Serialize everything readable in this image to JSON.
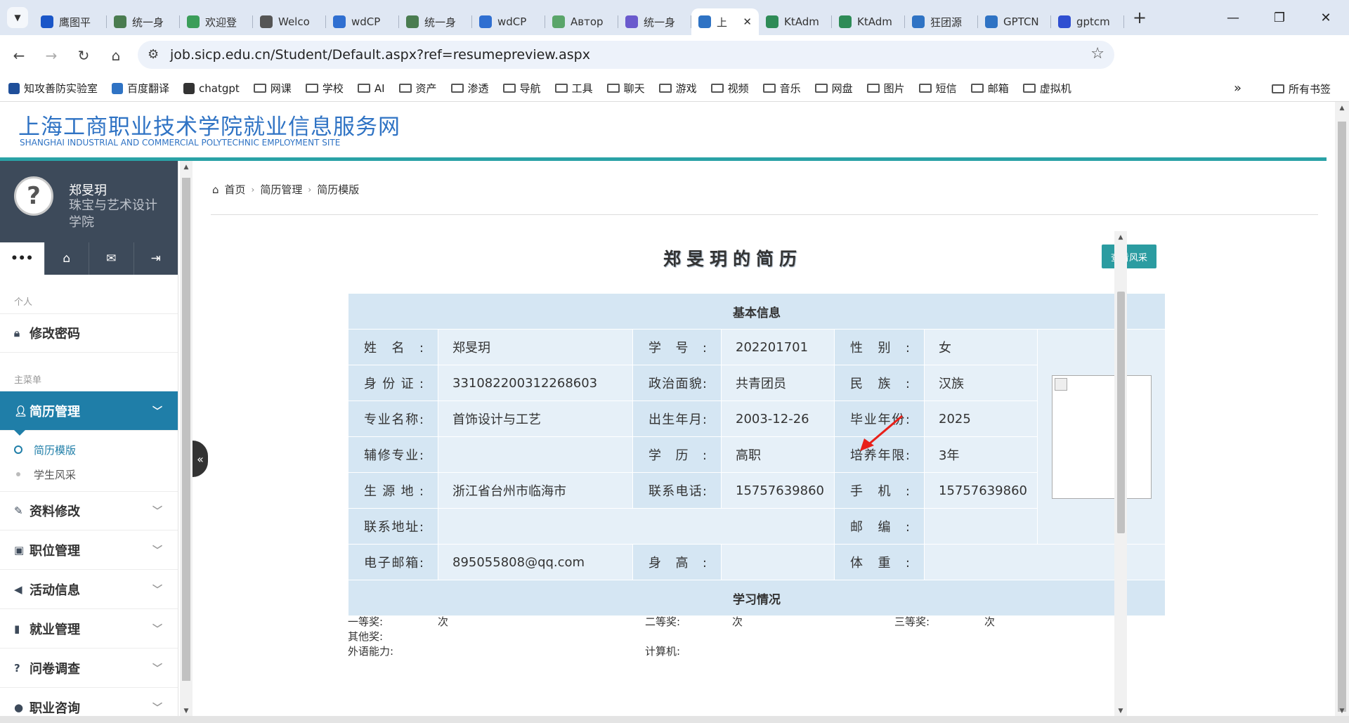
{
  "browser": {
    "tabs": [
      {
        "title": "鹰图平",
        "fav_color": "#1a56c8"
      },
      {
        "title": "统一身",
        "fav_color": "#4a7c50"
      },
      {
        "title": "欢迎登",
        "fav_color": "#3b9e5a"
      },
      {
        "title": "Welco",
        "fav_color": "#555555"
      },
      {
        "title": "wdCP",
        "fav_color": "#2f6fd1"
      },
      {
        "title": "统一身",
        "fav_color": "#4a7c50"
      },
      {
        "title": "wdCP",
        "fav_color": "#2f6fd1"
      },
      {
        "title": "Автор",
        "fav_color": "#5aa56a"
      },
      {
        "title": "统一身",
        "fav_color": "#6a5acd"
      },
      {
        "title": "上",
        "fav_color": "#2f73c4",
        "active": true
      },
      {
        "title": "KtAdm",
        "fav_color": "#2e8b57"
      },
      {
        "title": "KtAdm",
        "fav_color": "#2e8b57"
      },
      {
        "title": "狂团源",
        "fav_color": "#2f73c4"
      },
      {
        "title": "GPTCN",
        "fav_color": "#2f73c4"
      },
      {
        "title": "gptcm",
        "fav_color": "#2f4fd1"
      }
    ],
    "url": "job.sicp.edu.cn/Student/Default.aspx?ref=resumepreview.aspx",
    "bookmarks": [
      "知攻善防实验室",
      "百度翻译",
      "chatgpt",
      "网课",
      "学校",
      "AI",
      "资产",
      "渗透",
      "导航",
      "工具",
      "聊天",
      "游戏",
      "视频",
      "音乐",
      "网盘",
      "图片",
      "短信",
      "邮箱",
      "虚拟机"
    ],
    "all_bookmarks": "所有书签"
  },
  "site": {
    "title_cn": "上海工商职业技术学院就业信息服务网",
    "title_en": "SHANGHAI INDUSTRIAL AND COMMERCIAL POLYTECHNIC EMPLOYMENT SITE"
  },
  "sidebar": {
    "user_name": "郑旻玥",
    "user_dept": "珠宝与艺术设计学院",
    "section_personal": "个人",
    "change_password": "修改密码",
    "section_main": "主菜单",
    "menu": [
      "简历管理",
      "资料修改",
      "职位管理",
      "活动信息",
      "就业管理",
      "问卷调查",
      "职业咨询"
    ],
    "submenu": [
      "简历模版",
      "学生风采"
    ]
  },
  "breadcrumb": [
    "首页",
    "简历管理",
    "简历模版"
  ],
  "resume": {
    "title": "郑旻玥的简历",
    "view_button": "查看风采",
    "section_basic": "基本信息",
    "section_study": "学习情况",
    "labels": {
      "name": "姓名:",
      "student_id": "学号:",
      "gender": "性别:",
      "id_card": "身份证:",
      "political": "政治面貌:",
      "ethnicity": "民族:",
      "major": "专业名称:",
      "birth": "出生年月:",
      "grad_year": "毕业年份:",
      "minor": "辅修专业:",
      "education": "学历:",
      "duration": "培养年限:",
      "origin": "生源地:",
      "phone": "联系电话:",
      "mobile": "手机:",
      "address": "联系地址:",
      "postcode": "邮编:",
      "email": "电子邮箱:",
      "height": "身高:",
      "weight": "体重:",
      "first_prize": "一等奖:",
      "second_prize": "二等奖:",
      "third_prize": "三等奖:",
      "other_prize": "其他奖:",
      "foreign_lang": "外语能力:",
      "computer": "计算机:"
    },
    "values": {
      "name": "郑旻玥",
      "student_id": "202201701",
      "gender": "女",
      "id_card": "331082200312268603",
      "political": "共青团员",
      "ethnicity": "汉族",
      "major": "首饰设计与工艺",
      "birth": "2003-12-26",
      "grad_year": "2025",
      "minor": "",
      "education": "高职",
      "duration": "3年",
      "origin": "浙江省台州市临海市",
      "phone": "15757639860",
      "mobile": "15757639860",
      "address": "",
      "postcode": "",
      "email": "895055808@qq.com",
      "height": "",
      "weight": "",
      "first_prize": "次",
      "second_prize": "次",
      "third_prize": "次",
      "other_prize": "",
      "foreign_lang": "",
      "computer": ""
    }
  },
  "colors": {
    "accent": "#2aa2a6",
    "active_menu": "#1f7ea8",
    "link_blue": "#2f73c4",
    "annotation": "#e8201a"
  }
}
